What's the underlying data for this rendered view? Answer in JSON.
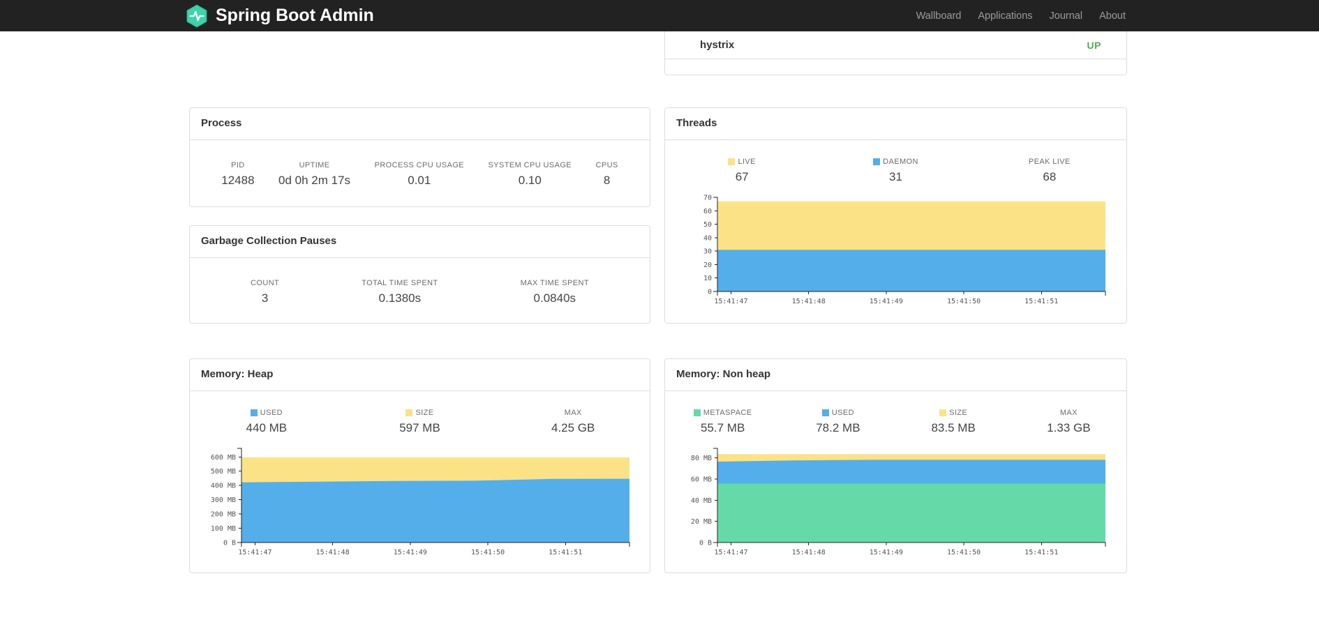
{
  "colors": {
    "logo_teal": "#3ed4ab",
    "status_up": "#4caf50",
    "series_yellow": "#fbe287",
    "series_blue": "#54aeea",
    "series_green": "#66d9a8"
  },
  "navbar": {
    "brand": "Spring Boot Admin",
    "links": [
      {
        "label": "Wallboard"
      },
      {
        "label": "Applications"
      },
      {
        "label": "Journal"
      },
      {
        "label": "About"
      }
    ]
  },
  "applications_panel": {
    "app_name": "hystrix",
    "status": "UP"
  },
  "process": {
    "title": "Process",
    "stats": [
      {
        "label": "PID",
        "value": "12488"
      },
      {
        "label": "UPTIME",
        "value": "0d 0h 2m 17s"
      },
      {
        "label": "PROCESS CPU USAGE",
        "value": "0.01"
      },
      {
        "label": "SYSTEM CPU USAGE",
        "value": "0.10"
      },
      {
        "label": "CPUS",
        "value": "8"
      }
    ]
  },
  "gc": {
    "title": "Garbage Collection Pauses",
    "stats": [
      {
        "label": "COUNT",
        "value": "3"
      },
      {
        "label": "TOTAL TIME SPENT",
        "value": "0.1380s"
      },
      {
        "label": "MAX TIME SPENT",
        "value": "0.0840s"
      }
    ]
  },
  "threads": {
    "title": "Threads",
    "legend": [
      {
        "label": "LIVE",
        "value": "67",
        "swatch": "#fbe287"
      },
      {
        "label": "DAEMON",
        "value": "31",
        "swatch": "#54aeea"
      },
      {
        "label": "PEAK LIVE",
        "value": "68",
        "swatch": null
      }
    ]
  },
  "heap": {
    "title": "Memory: Heap",
    "legend": [
      {
        "label": "USED",
        "value": "440 MB",
        "swatch": "#54aeea"
      },
      {
        "label": "SIZE",
        "value": "597 MB",
        "swatch": "#fbe287"
      },
      {
        "label": "MAX",
        "value": "4.25 GB",
        "swatch": null
      }
    ]
  },
  "nonheap": {
    "title": "Memory: Non heap",
    "legend": [
      {
        "label": "METASPACE",
        "value": "55.7 MB",
        "swatch": "#66d9a8"
      },
      {
        "label": "USED",
        "value": "78.2 MB",
        "swatch": "#54aeea"
      },
      {
        "label": "SIZE",
        "value": "83.5 MB",
        "swatch": "#fbe287"
      },
      {
        "label": "MAX",
        "value": "1.33 GB",
        "swatch": null
      }
    ]
  },
  "chart_data": [
    {
      "id": "threads-chart",
      "type": "area",
      "title": "Threads",
      "x_ticks": [
        "15:41:47",
        "15:41:48",
        "15:41:49",
        "15:41:50",
        "15:41:51"
      ],
      "series": [
        {
          "name": "LIVE",
          "color": "#fbe287",
          "values": [
            67,
            67,
            67,
            67,
            67,
            67
          ]
        },
        {
          "name": "DAEMON",
          "color": "#54aeea",
          "values": [
            31,
            31,
            31,
            31,
            31,
            31
          ]
        }
      ],
      "ylim": [
        0,
        70
      ],
      "yticks": [
        {
          "v": 0,
          "label": "0"
        },
        {
          "v": 10,
          "label": "10"
        },
        {
          "v": 20,
          "label": "20"
        },
        {
          "v": 30,
          "label": "30"
        },
        {
          "v": 40,
          "label": "40"
        },
        {
          "v": 50,
          "label": "50"
        },
        {
          "v": 60,
          "label": "60"
        },
        {
          "v": 70,
          "label": "70"
        }
      ],
      "grid": false,
      "legend_position": "above"
    },
    {
      "id": "heap-chart",
      "type": "area",
      "title": "Memory: Heap",
      "x_ticks": [
        "15:41:47",
        "15:41:48",
        "15:41:49",
        "15:41:50",
        "15:41:51"
      ],
      "series": [
        {
          "name": "SIZE",
          "color": "#fbe287",
          "values": [
            597,
            597,
            597,
            597,
            597,
            597
          ]
        },
        {
          "name": "USED",
          "color": "#54aeea",
          "values": [
            422,
            427,
            431,
            433,
            446,
            447
          ]
        }
      ],
      "ylim": [
        0,
        660
      ],
      "yticks": [
        {
          "v": 0,
          "label": "0 B"
        },
        {
          "v": 100,
          "label": "100 MB"
        },
        {
          "v": 200,
          "label": "200 MB"
        },
        {
          "v": 300,
          "label": "300 MB"
        },
        {
          "v": 400,
          "label": "400 MB"
        },
        {
          "v": 500,
          "label": "500 MB"
        },
        {
          "v": 600,
          "label": "600 MB"
        }
      ],
      "grid": false,
      "legend_position": "above"
    },
    {
      "id": "nonheap-chart",
      "type": "area",
      "title": "Memory: Non heap",
      "x_ticks": [
        "15:41:47",
        "15:41:48",
        "15:41:49",
        "15:41:50",
        "15:41:51"
      ],
      "series": [
        {
          "name": "SIZE",
          "color": "#fbe287",
          "values": [
            83.5,
            83.5,
            83.5,
            83.5,
            83.5,
            83.5
          ]
        },
        {
          "name": "USED",
          "color": "#54aeea",
          "values": [
            76.5,
            77.6,
            78.2,
            78.2,
            78.2,
            78.2
          ]
        },
        {
          "name": "METASPACE",
          "color": "#66d9a8",
          "values": [
            55.7,
            55.7,
            55.7,
            55.7,
            55.7,
            55.7
          ]
        }
      ],
      "ylim": [
        0,
        89
      ],
      "yticks": [
        {
          "v": 0,
          "label": "0 B"
        },
        {
          "v": 20,
          "label": "20 MB"
        },
        {
          "v": 40,
          "label": "40 MB"
        },
        {
          "v": 60,
          "label": "60 MB"
        },
        {
          "v": 80,
          "label": "80 MB"
        }
      ],
      "grid": false,
      "legend_position": "above"
    }
  ]
}
